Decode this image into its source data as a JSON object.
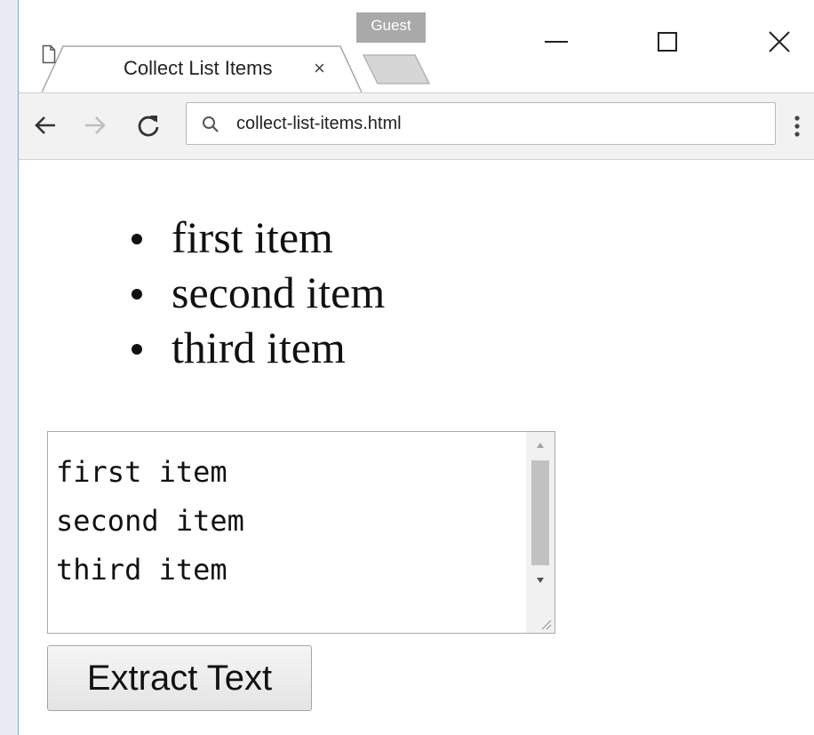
{
  "titlebar": {
    "guest_label": "Guest"
  },
  "tab": {
    "title": "Collect List Items",
    "close_glyph": "×",
    "icon": "page-icon"
  },
  "window_controls": {
    "minimize_icon": "minimize-icon",
    "maximize_icon": "maximize-icon",
    "close_glyph": "✕"
  },
  "toolbar": {
    "back_icon": "arrow-left-icon",
    "forward_icon": "arrow-right-icon",
    "reload_icon": "reload-icon",
    "address": "collect-list-items.html",
    "search_icon": "search-icon",
    "menu_icon": "kebab-menu-icon"
  },
  "page": {
    "list_items": [
      "first item",
      "second item",
      "third item"
    ],
    "textarea_value": "first item\nsecond item\nthird item",
    "extract_button_label": "Extract Text"
  },
  "colors": {
    "window_border": "#7aa7d9",
    "toolbar_bg": "#f2f2f2",
    "guest_badge": "#a9a9a9"
  }
}
